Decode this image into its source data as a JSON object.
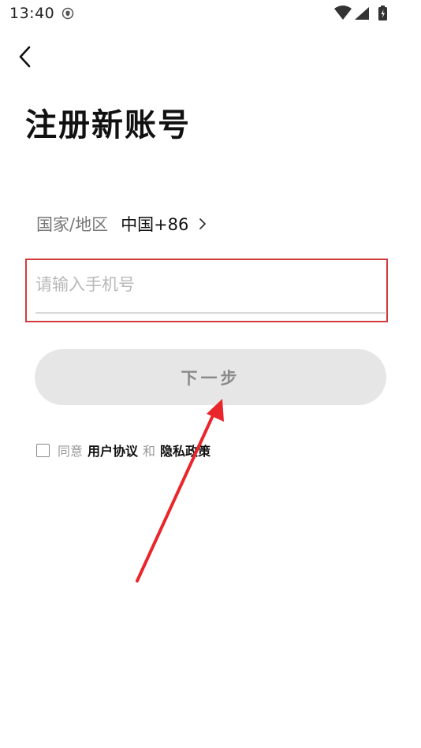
{
  "status_bar": {
    "time": "13:40"
  },
  "header": {
    "back_icon": "chevron-left-icon",
    "title": "注册新账号"
  },
  "region": {
    "label": "国家/地区",
    "value": "中国+86",
    "chevron_icon": "chevron-right-icon"
  },
  "phone": {
    "placeholder": "请输入手机号",
    "value": ""
  },
  "next_button": {
    "label": "下一步"
  },
  "agreement": {
    "prefix": "同意",
    "user_agreement": "用户协议",
    "conjunction": "和",
    "privacy_policy": "隐私政策",
    "checked": false
  },
  "annotation": {
    "highlight_color": "#d23c3c",
    "arrow_color": "#e8262c"
  },
  "colors": {
    "button_bg": "#e6e6e6",
    "button_text": "#8a8a8a",
    "placeholder": "#b8b8b8",
    "title": "#111111"
  }
}
